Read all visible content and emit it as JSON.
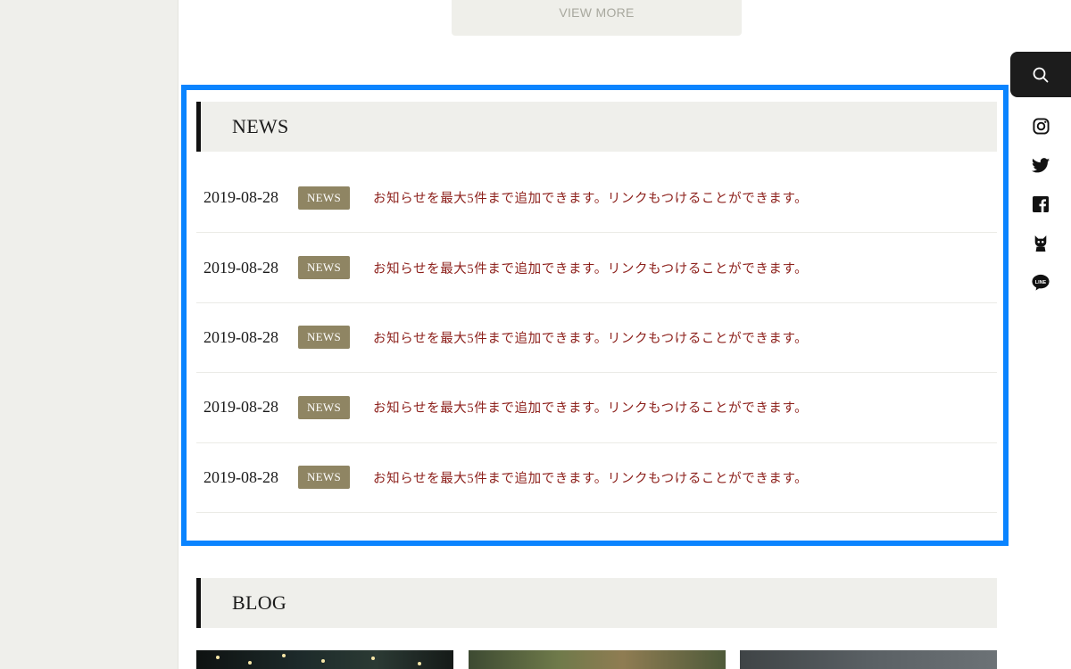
{
  "view_more": {
    "label": "VIEW MORE"
  },
  "news": {
    "title": "NEWS",
    "items": [
      {
        "date": "2019-08-28",
        "badge": "NEWS",
        "text": "お知らせを最大5件まで追加できます。リンクもつけることができます。"
      },
      {
        "date": "2019-08-28",
        "badge": "NEWS",
        "text": "お知らせを最大5件まで追加できます。リンクもつけることができます。"
      },
      {
        "date": "2019-08-28",
        "badge": "NEWS",
        "text": "お知らせを最大5件まで追加できます。リンクもつけることができます。"
      },
      {
        "date": "2019-08-28",
        "badge": "NEWS",
        "text": "お知らせを最大5件まで追加できます。リンクもつけることができます。"
      },
      {
        "date": "2019-08-28",
        "badge": "NEWS",
        "text": "お知らせを最大5件まで追加できます。リンクもつけることができます。"
      }
    ]
  },
  "blog": {
    "title": "BLOG"
  },
  "sidebar": {
    "icons": [
      "search-icon",
      "instagram-icon",
      "twitter-icon",
      "facebook-icon",
      "mascot-icon",
      "line-icon"
    ],
    "line_text": "LINE"
  },
  "colors": {
    "highlight": "#0a84ff",
    "badge": "#8f8563",
    "news_text": "#8c1f1a",
    "header_bg": "#efefeb",
    "search_bg": "#1c1c1c"
  }
}
